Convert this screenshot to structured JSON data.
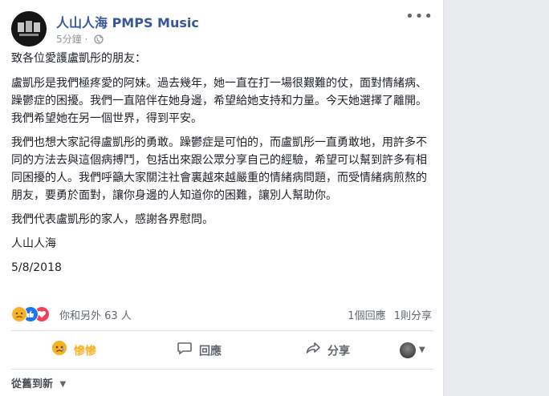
{
  "post": {
    "page_name": "人山人海 PMPS Music",
    "time": "5分鐘",
    "separator": "·",
    "more": "•••"
  },
  "body": {
    "greeting": "致各位愛護盧凱彤的朋友：",
    "p1": "盧凱彤是我們極疼愛的阿妹。過去幾年，她一直在打一場很艱難的仗，面對情緒病、躁鬱症的困擾。我們一直陪伴在她身邊，希望給她支持和力量。今天她選擇了離開。我們希望她在另一個世界，得到平安。",
    "p2": "我們也想大家記得盧凱彤的勇敢。躁鬱症是可怕的，而盧凱彤一直勇敢地，用許多不同的方法去與這個病搏鬥，包括出來跟公眾分享自己的經驗，希望可以幫到許多有相同困擾的人。我們呼籲大家關注社會裏越來越嚴重的情緒病問題，而受情緒病煎熬的朋友，要勇於面對，讓你身邊的人知道你的困難，讓別人幫助你。",
    "p3": "我們代表盧凱彤的家人，感謝各界慰問。",
    "signature": "人山人海",
    "date": "5/8/2018"
  },
  "reactions": {
    "summary": "你和另外 63 人",
    "comments": "1個回應",
    "shares": "1則分享",
    "icons": [
      "sad-icon",
      "like-icon",
      "love-icon"
    ]
  },
  "actions": {
    "react_label": "慘慘",
    "comment_label": "回應",
    "share_label": "分享"
  },
  "sort": {
    "label": "從舊到新"
  },
  "colors": {
    "link": "#365899",
    "sad": "#f7b125",
    "like": "#1877f2",
    "love": "#f33e58",
    "muted": "#606770"
  }
}
